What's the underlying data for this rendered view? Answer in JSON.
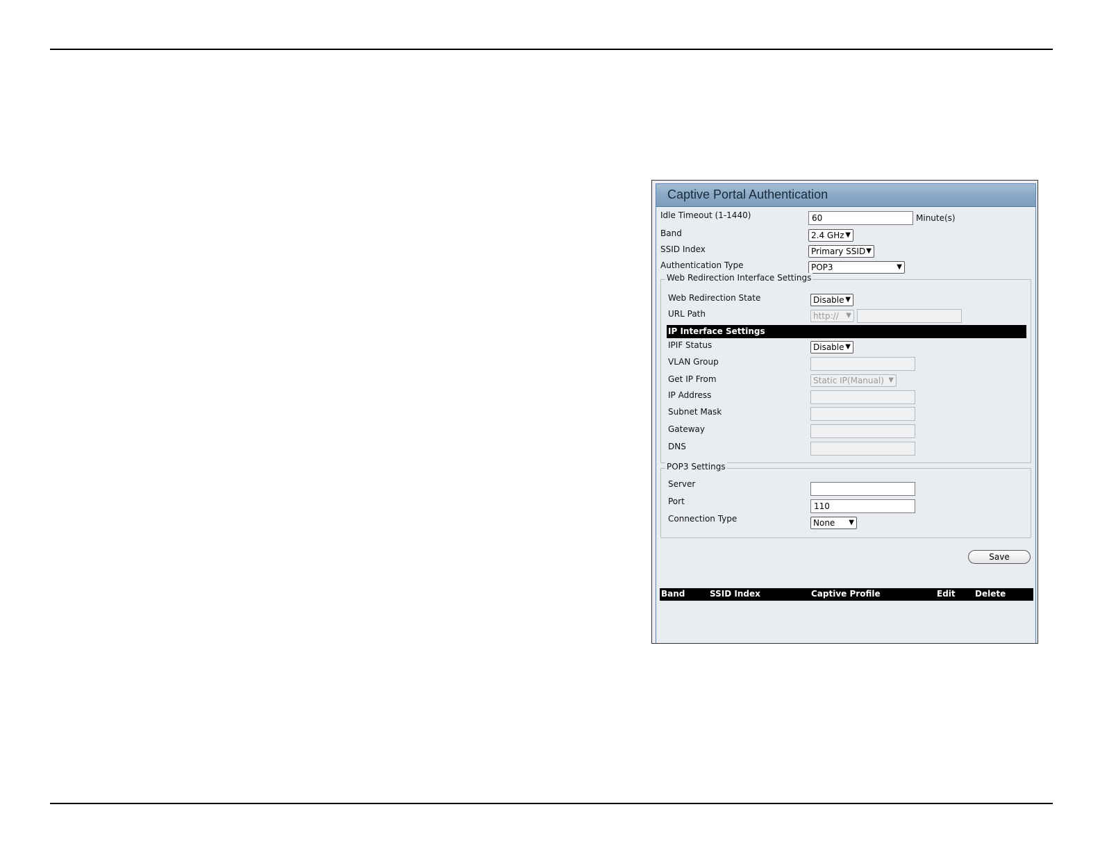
{
  "panel": {
    "title": "Captive Portal Authentication"
  },
  "form": {
    "idle_timeout": {
      "label": "Idle Timeout (1-1440)",
      "value": "60",
      "unit": "Minute(s)"
    },
    "band": {
      "label": "Band",
      "value": "2.4 GHz"
    },
    "ssid_index": {
      "label": "SSID Index",
      "value": "Primary SSID"
    },
    "auth_type": {
      "label": "Authentication Type",
      "value": "POP3"
    }
  },
  "web_redirection": {
    "legend": "Web Redirection Interface Settings",
    "state": {
      "label": "Web Redirection State",
      "value": "Disable"
    },
    "url_path": {
      "label": "URL Path",
      "scheme": "http://",
      "value": ""
    }
  },
  "ip_interface": {
    "header": "IP Interface Settings",
    "ipif_status": {
      "label": "IPIF Status",
      "value": "Disable"
    },
    "vlan_group": {
      "label": "VLAN Group",
      "value": ""
    },
    "get_ip_from": {
      "label": "Get IP From",
      "value": "Static IP(Manual)"
    },
    "ip_address": {
      "label": "IP Address",
      "value": ""
    },
    "subnet_mask": {
      "label": "Subnet Mask",
      "value": ""
    },
    "gateway": {
      "label": "Gateway",
      "value": ""
    },
    "dns": {
      "label": "DNS",
      "value": ""
    }
  },
  "pop3": {
    "legend": "POP3 Settings",
    "server": {
      "label": "Server",
      "value": ""
    },
    "port": {
      "label": "Port",
      "value": "110"
    },
    "connection_type": {
      "label": "Connection Type",
      "value": "None"
    }
  },
  "actions": {
    "save_label": "Save"
  },
  "table": {
    "columns": [
      "Band",
      "SSID Index",
      "Captive Profile",
      "Edit",
      "Delete"
    ]
  },
  "icons": {
    "dropdown": "chevron-down-icon"
  }
}
